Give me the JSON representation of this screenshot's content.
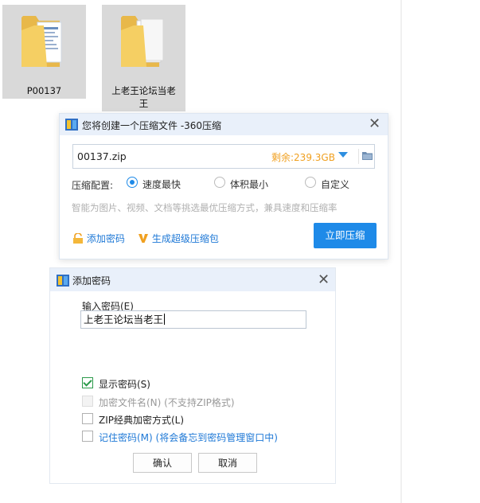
{
  "desktop": {
    "folders": [
      {
        "label": "P00137"
      },
      {
        "label_line1": "上老王论坛当老",
        "label_line2": "王"
      }
    ]
  },
  "compress_dialog": {
    "title": "您将创建一个压缩文件 -360压缩",
    "filename": "00137.zip",
    "remaining": "剩余:239.3GB",
    "config_label": "压缩配置:",
    "options": [
      "速度最快",
      "体积最小",
      "自定义"
    ],
    "selected_option": "速度最快",
    "hint": "智能为图片、视频、文档等挑选最优压缩方式，兼具速度和压缩率",
    "add_password_link": "添加密码",
    "super_compress_link": "生成超级压缩包",
    "compress_button": "立即压缩"
  },
  "password_dialog": {
    "title": "添加密码",
    "input_label": "输入密码(E)",
    "password_value": "上老王论坛当老王",
    "show_password": {
      "label": "显示密码(S)",
      "checked": true
    },
    "encrypt_filenames": {
      "label": "加密文件名(N)",
      "note": "(不支持ZIP格式)",
      "disabled": true
    },
    "zip_classic": {
      "label": "ZIP经典加密方式(L)",
      "checked": false
    },
    "remember_password": {
      "label": "记住密码(M)",
      "note": "(将会备忘到密码管理窗口中)",
      "checked": false
    },
    "ok_button": "确认",
    "cancel_button": "取消"
  },
  "colors": {
    "accent": "#1e8ae8",
    "remaining": "#f0a020",
    "check": "#2b9a4a",
    "link": "#1e78d6"
  }
}
